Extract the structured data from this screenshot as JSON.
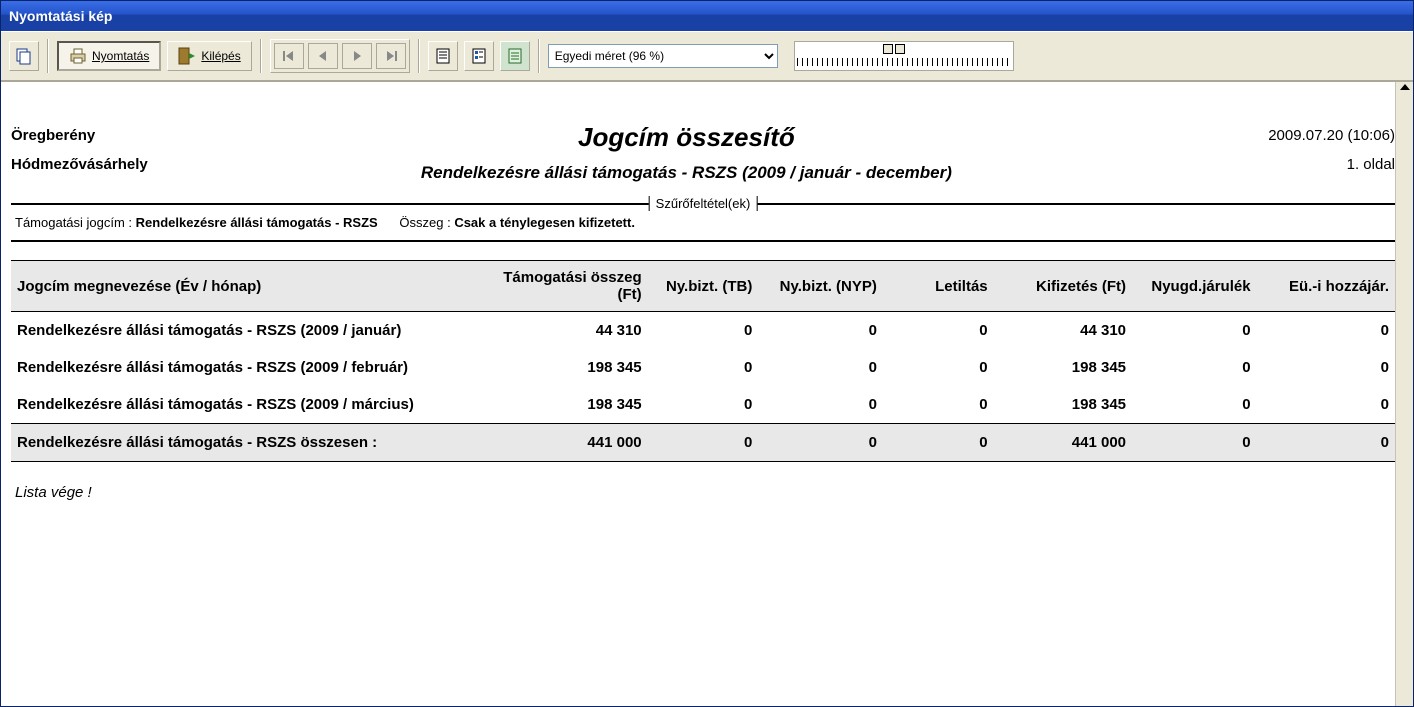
{
  "window": {
    "title": "Nyomtatási kép"
  },
  "toolbar": {
    "print": "Nyomtatás",
    "exit": "Kilépés",
    "zoom_selected": "Egyedi méret (96 %)"
  },
  "report": {
    "org_top": "Öregberény",
    "org_bottom": "Hódmezővásárhely",
    "title": "Jogcím összesítő",
    "subtitle": "Rendelkezésre állási támogatás - RSZS (2009 / január - december)",
    "datetime": "2009.07.20 (10:06)",
    "page": "1. oldal"
  },
  "filters": {
    "legend": "Szűrőfeltétel(ek)",
    "l1_label": "Támogatási jogcím : ",
    "l1_value": "Rendelkezésre állási támogatás - RSZS",
    "l2_label": "Összeg : ",
    "l2_value": "Csak a ténylegesen kifizetett."
  },
  "table": {
    "headers": {
      "c0": "Jogcím megnevezése (Év / hónap)",
      "c1": "Támogatási összeg (Ft)",
      "c2": "Ny.bizt. (TB)",
      "c3": "Ny.bizt. (NYP)",
      "c4": "Letiltás",
      "c5": "Kifizetés (Ft)",
      "c6": "Nyugd.járulék",
      "c7": "Eü.-i hozzájár."
    },
    "rows": [
      {
        "c0": "Rendelkezésre állási támogatás - RSZS (2009 / január)",
        "c1": "44 310",
        "c2": "0",
        "c3": "0",
        "c4": "0",
        "c5": "44 310",
        "c6": "0",
        "c7": "0"
      },
      {
        "c0": "Rendelkezésre állási támogatás - RSZS (2009 / február)",
        "c1": "198 345",
        "c2": "0",
        "c3": "0",
        "c4": "0",
        "c5": "198 345",
        "c6": "0",
        "c7": "0"
      },
      {
        "c0": "Rendelkezésre állási támogatás - RSZS (2009 / március)",
        "c1": "198 345",
        "c2": "0",
        "c3": "0",
        "c4": "0",
        "c5": "198 345",
        "c6": "0",
        "c7": "0"
      }
    ],
    "total": {
      "c0": "Rendelkezésre állási támogatás - RSZS összesen :",
      "c1": "441 000",
      "c2": "0",
      "c3": "0",
      "c4": "0",
      "c5": "441 000",
      "c6": "0",
      "c7": "0"
    }
  },
  "list_end": "Lista vége !"
}
